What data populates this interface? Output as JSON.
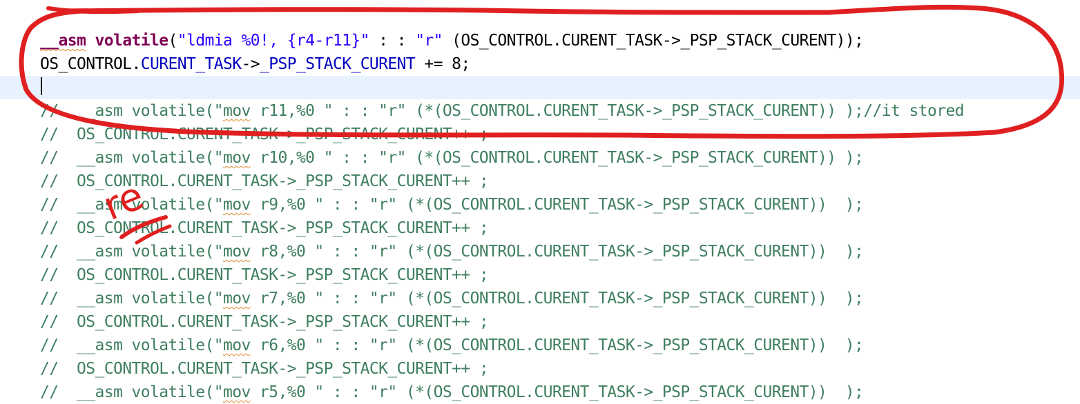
{
  "lines": [
    {
      "tokens": [
        {
          "text": "__asm",
          "cls": "kw squig"
        },
        {
          "text": " ",
          "cls": ""
        },
        {
          "text": "volatile",
          "cls": "kw"
        },
        {
          "text": "(",
          "cls": ""
        },
        {
          "text": "\"ldmia %0!, {r4-r11}\"",
          "cls": "str"
        },
        {
          "text": " : : ",
          "cls": ""
        },
        {
          "text": "\"r\"",
          "cls": "str"
        },
        {
          "text": " (OS_CONTROL.CURENT_TASK->_PSP_STACK_CURENT));",
          "cls": ""
        }
      ]
    },
    {
      "tokens": [
        {
          "text": "OS_CONTROL.",
          "cls": ""
        },
        {
          "text": "CURENT_TASK",
          "cls": "field"
        },
        {
          "text": "->",
          "cls": ""
        },
        {
          "text": "_PSP_STACK_CURENT",
          "cls": "field"
        },
        {
          "text": " += 8;",
          "cls": ""
        }
      ]
    },
    {
      "tokens": []
    },
    {
      "tokens": [
        {
          "text": "//  __asm volatile(\"",
          "cls": "cmt"
        },
        {
          "text": "mov",
          "cls": "cmt squig"
        },
        {
          "text": " r11,%0 \" : : \"r\" (*(OS_CONTROL.CURENT_TASK->_PSP_STACK_CURENT)) );//it stored",
          "cls": "cmt"
        }
      ]
    },
    {
      "tokens": [
        {
          "text": "//  OS_CONTROL.CURENT_TASK->_PSP_STACK_CURENT++ ;",
          "cls": "cmt"
        }
      ]
    },
    {
      "tokens": [
        {
          "text": "//  __asm volatile(\"",
          "cls": "cmt"
        },
        {
          "text": "mov",
          "cls": "cmt squig"
        },
        {
          "text": " r10,%0 \" : : \"r\" (*(OS_CONTROL.CURENT_TASK->_PSP_STACK_CURENT)) );",
          "cls": "cmt"
        }
      ]
    },
    {
      "tokens": [
        {
          "text": "//  OS_CONTROL.CURENT_TASK->_PSP_STACK_CURENT++ ;",
          "cls": "cmt"
        }
      ]
    },
    {
      "tokens": [
        {
          "text": "//  __asm volatile(\"",
          "cls": "cmt"
        },
        {
          "text": "mov",
          "cls": "cmt squig"
        },
        {
          "text": " r9,%0 \" : : \"r\" (*(OS_CONTROL.CURENT_TASK->_PSP_STACK_CURENT))  );",
          "cls": "cmt"
        }
      ]
    },
    {
      "tokens": [
        {
          "text": "//  OS_CONTROL.CURENT_TASK->_PSP_STACK_CURENT++ ;",
          "cls": "cmt"
        }
      ]
    },
    {
      "tokens": [
        {
          "text": "//  __asm volatile(\"",
          "cls": "cmt"
        },
        {
          "text": "mov",
          "cls": "cmt squig"
        },
        {
          "text": " r8,%0 \" : : \"r\" (*(OS_CONTROL.CURENT_TASK->_PSP_STACK_CURENT))  );",
          "cls": "cmt"
        }
      ]
    },
    {
      "tokens": [
        {
          "text": "//  OS_CONTROL.CURENT_TASK->_PSP_STACK_CURENT++ ;",
          "cls": "cmt"
        }
      ]
    },
    {
      "tokens": [
        {
          "text": "//  __asm volatile(\"",
          "cls": "cmt"
        },
        {
          "text": "mov",
          "cls": "cmt squig"
        },
        {
          "text": " r7,%0 \" : : \"r\" (*(OS_CONTROL.CURENT_TASK->_PSP_STACK_CURENT))  );",
          "cls": "cmt"
        }
      ]
    },
    {
      "tokens": [
        {
          "text": "//  OS_CONTROL.CURENT_TASK->_PSP_STACK_CURENT++ ;",
          "cls": "cmt"
        }
      ]
    },
    {
      "tokens": [
        {
          "text": "//  __asm volatile(\"",
          "cls": "cmt"
        },
        {
          "text": "mov",
          "cls": "cmt squig"
        },
        {
          "text": " r6,%0 \" : : \"r\" (*(OS_CONTROL.CURENT_TASK->_PSP_STACK_CURENT))  );",
          "cls": "cmt"
        }
      ]
    },
    {
      "tokens": [
        {
          "text": "//  OS_CONTROL.CURENT_TASK->_PSP_STACK_CURENT++ ;",
          "cls": "cmt"
        }
      ]
    },
    {
      "tokens": [
        {
          "text": "//  __asm volatile(\"",
          "cls": "cmt"
        },
        {
          "text": "mov",
          "cls": "cmt squig"
        },
        {
          "text": " r5,%0 \" : : \"r\" (*(OS_CONTROL.CURENT_TASK->_PSP_STACK_CURENT))  );",
          "cls": "cmt"
        }
      ]
    }
  ],
  "colors": {
    "keyword": "#7f0055",
    "string": "#2a00ff",
    "field": "#0000c0",
    "comment": "#3f7f5f",
    "current_line": "#e8f2fe",
    "annotation": "#e02020"
  },
  "annotation": {
    "scribble_text": "re"
  }
}
